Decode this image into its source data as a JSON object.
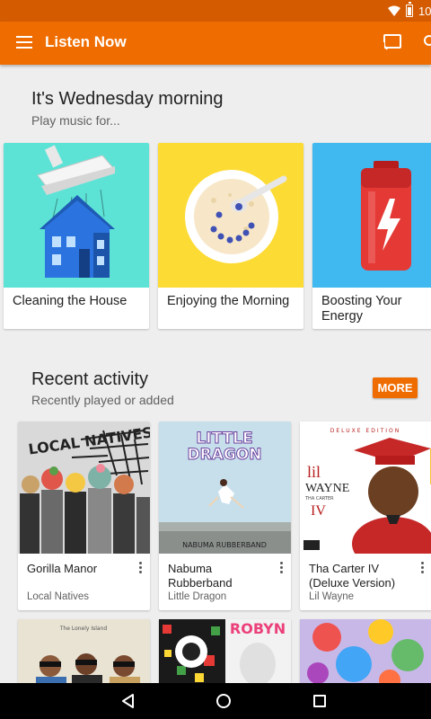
{
  "status_bar": {
    "time": "10:"
  },
  "toolbar": {
    "title": "Listen Now"
  },
  "play_for": {
    "title": "It's Wednesday morning",
    "subtitle": "Play music for...",
    "cards": [
      {
        "label": "Cleaning the House",
        "bg": "#5de3d6"
      },
      {
        "label": "Enjoying the Morning",
        "bg": "#fddb35"
      },
      {
        "label": "Boosting Your Energy",
        "bg": "#40b8f0"
      }
    ]
  },
  "recent": {
    "title": "Recent activity",
    "subtitle": "Recently played or added",
    "more_label": "MORE",
    "albums": [
      {
        "title": "Gorilla Manor",
        "artist": "Local Natives",
        "art_text": "LOCAL NATIVES"
      },
      {
        "title": "Nabuma Rubberband",
        "artist": "Little Dragon",
        "art_text_1": "LITTLE",
        "art_text_2": "DRAGON",
        "art_text_3": "NABUMA RUBBERBAND"
      },
      {
        "title": "Tha Carter IV (Deluxe Version)",
        "artist": "Lil Wayne",
        "art_text_1": "DELUXE EDITION",
        "art_text_2": "lil",
        "art_text_3": "WAYNE",
        "art_text_4": "THA CARTER",
        "art_text_5": "IV"
      }
    ],
    "row2": [
      {
        "art_text": "The Lonely Island"
      },
      {
        "art_text": "ROBYN"
      },
      {
        "art_text": ""
      }
    ]
  },
  "accent_color": "#ef6c00"
}
